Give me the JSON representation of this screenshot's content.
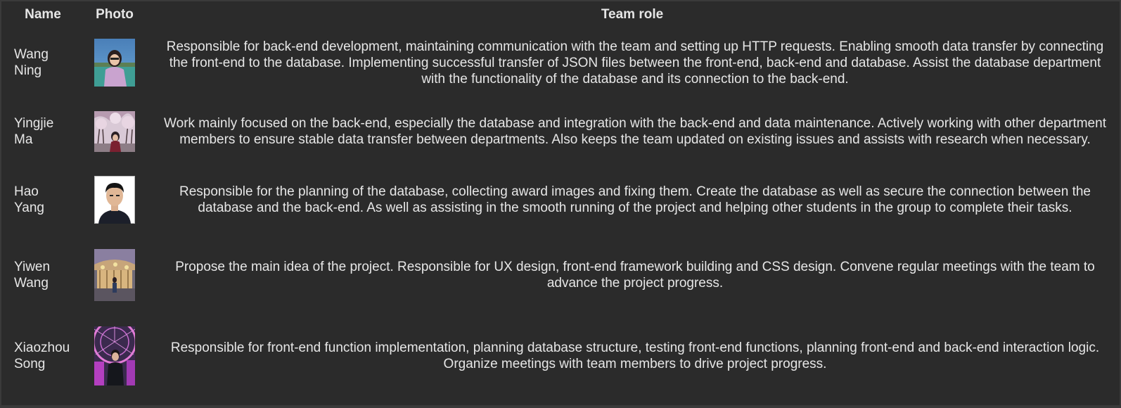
{
  "table": {
    "headers": {
      "name": "Name",
      "photo": "Photo",
      "role": "Team role"
    },
    "rows": [
      {
        "name": "Wang Ning",
        "role": "Responsible for back-end development, maintaining communication with the team and setting up HTTP requests. Enabling smooth data transfer by connecting the front-end to the database. Implementing successful transfer of JSON files between the front-end, back-end and database. Assist the database department with the functionality of the database and its connection to the back-end."
      },
      {
        "name": "Yingjie Ma",
        "role": "Work mainly focused on the back-end, especially the database and integration with the back-end and data maintenance. Actively working with other department members to ensure stable data transfer between departments. Also keeps the team updated on existing issues and assists with research when necessary."
      },
      {
        "name": "Hao Yang",
        "role": "Responsible for the planning of the database, collecting award images and fixing them. Create the database as well as secure the connection between the database and the back-end. As well as assisting in the smooth running of the project and helping other students in the group to complete their tasks."
      },
      {
        "name": "Yiwen Wang",
        "role": "Propose the main idea of the project. Responsible for UX design, front-end framework building and CSS design. Convene regular meetings with the team to advance the project progress."
      },
      {
        "name": "Xiaozhou Song",
        "role": "Responsible for front-end function implementation, planning database structure, testing front-end functions, planning front-end and back-end interaction logic. Organize meetings with team members to drive project progress."
      }
    ]
  }
}
